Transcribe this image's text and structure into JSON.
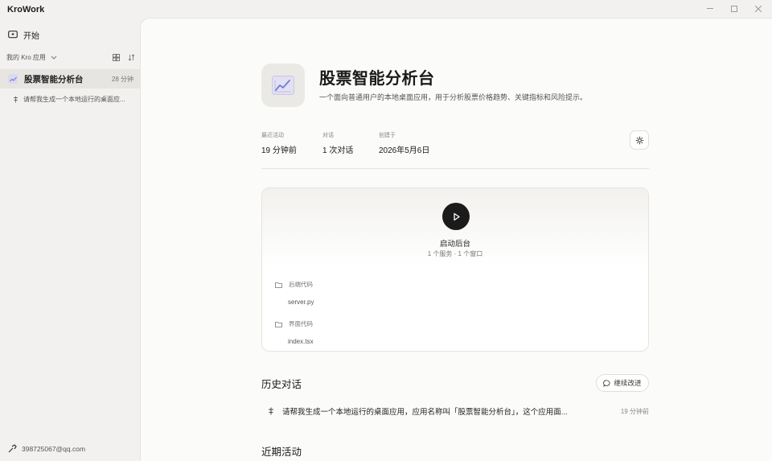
{
  "window": {
    "title": "KroWork",
    "controls": [
      "minimize",
      "maximize",
      "close"
    ]
  },
  "sidebar": {
    "start_label": "开始",
    "section_label": "我的 Kro 应用",
    "apps": [
      {
        "name": "股票智能分析台",
        "time": "28 分钟"
      }
    ],
    "conversations": [
      {
        "text": "请帮我生成一个本地运行的桌面应..."
      }
    ],
    "user_email": "398725067@qq.com"
  },
  "app": {
    "name": "股票智能分析台",
    "description": "一个面向普通用户的本地桌面应用，用于分析股票价格趋势、关键指标和风险提示。",
    "meta": [
      {
        "label": "最近活动",
        "value": "19 分钟前"
      },
      {
        "label": "对话",
        "value": "1 次对话"
      },
      {
        "label": "创建于",
        "value": "2026年5月6日"
      }
    ]
  },
  "launch": {
    "label": "启动后台",
    "sub": "1 个服务 · 1 个窗口",
    "backend_label": "后端代码",
    "backend_file": "server.py",
    "frontend_label": "界面代码",
    "frontend_file": "index.tsx"
  },
  "history": {
    "title": "历史对话",
    "continue_label": "继续改进",
    "items": [
      {
        "text": "请帮我生成一个本地运行的桌面应用，应用名称叫「股票智能分析台」，这个应用面...",
        "time": "19 分钟前"
      }
    ]
  },
  "recent": {
    "title": "近期活动"
  },
  "colors": {
    "accent": "#1b1b1b",
    "sidebar_bg": "#f2f1ef",
    "main_bg": "#fbfbfa",
    "chart_icon": "#6f7fd6"
  }
}
